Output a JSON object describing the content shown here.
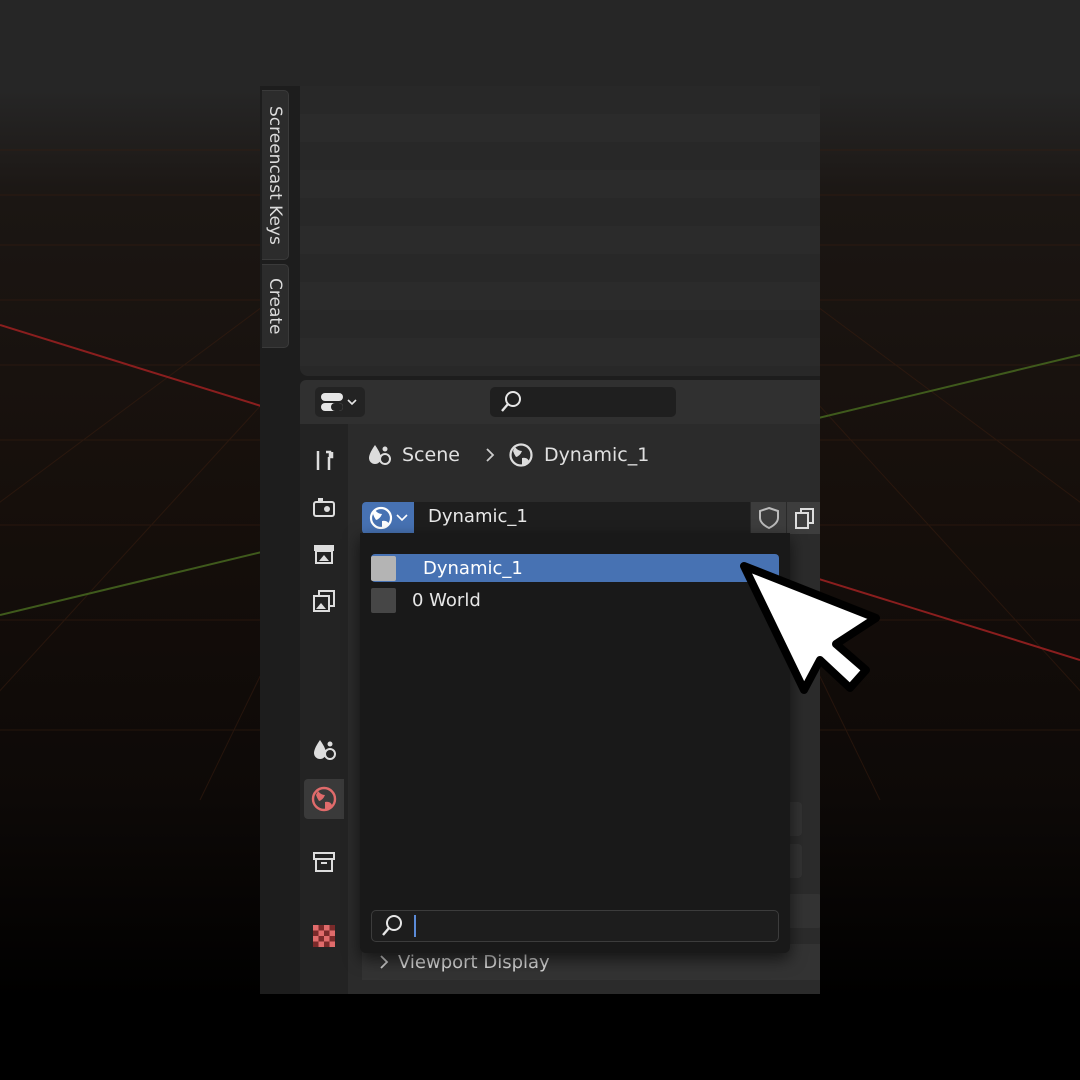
{
  "side_tabs": [
    "Screencast Keys",
    "Create"
  ],
  "header": {
    "editor_icon": "editor-type-icon",
    "search_placeholder": ""
  },
  "property_tabs": [
    {
      "icon": "tool-icon",
      "active": false
    },
    {
      "icon": "render-icon",
      "active": false
    },
    {
      "icon": "output-icon",
      "active": false
    },
    {
      "icon": "view-layer-icon",
      "active": false
    },
    {
      "icon": "scene-icon",
      "active": false
    },
    {
      "icon": "world-icon",
      "active": true
    },
    {
      "icon": "collection-icon",
      "active": false
    },
    {
      "icon": "texture-icon",
      "active": false
    }
  ],
  "breadcrumb": {
    "scene": "Scene",
    "world": "Dynamic_1"
  },
  "id_field": {
    "name": "Dynamic_1",
    "browse_icon": "world-icon",
    "fake_user_icon": "shield-icon",
    "duplicate_icon": "duplicate-icon"
  },
  "dropdown": {
    "items": [
      {
        "label": "Dynamic_1",
        "selected": true,
        "swatch": "#b4b4b4"
      },
      {
        "label": "0 World",
        "selected": false,
        "swatch": "#464646"
      }
    ],
    "search_value": ""
  },
  "panels": {
    "viewport_display": "Viewport Display"
  },
  "colors": {
    "accent": "#4772b3",
    "world_tab": "#e06b6b"
  }
}
